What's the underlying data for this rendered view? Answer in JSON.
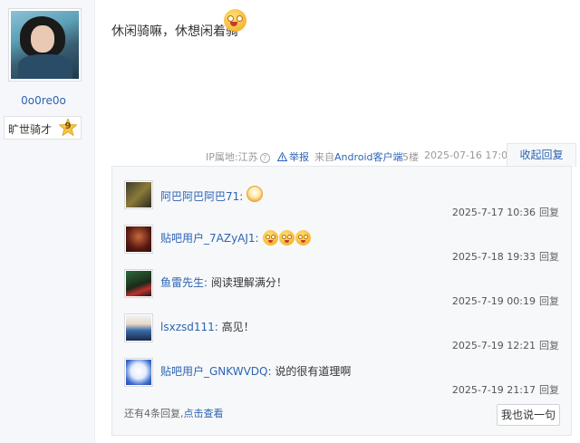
{
  "author": {
    "username": "0o0re0o",
    "level_name": "旷世骑才",
    "level_number": "9"
  },
  "post": {
    "text": "休闲骑嘛，休想闲着骑"
  },
  "meta": {
    "ip_location": "IP属地:江苏",
    "report_label": "举报",
    "source_prefix": "来自",
    "source_link": "Android客户端",
    "floor": "5楼",
    "datetime": "2025-07-16 17:01",
    "collapse_label": "收起回复"
  },
  "replies": [
    {
      "user": "阿巴阿巴阿巴71:",
      "text": "",
      "time": "2025-7-17 10:36",
      "reply_label": "回复"
    },
    {
      "user": "贴吧用户_7AZyAJ1:",
      "text": "",
      "time": "2025-7-18 19:33",
      "reply_label": "回复"
    },
    {
      "user": "鱼雷先生:",
      "text": "阅读理解满分！",
      "time": "2025-7-19 00:19",
      "reply_label": "回复"
    },
    {
      "user": "lsxzsd111:",
      "text": "高见！",
      "time": "2025-7-19 12:21",
      "reply_label": "回复"
    },
    {
      "user": "贴吧用户_GNKWVDQ:",
      "text": "说的很有道理啊",
      "time": "2025-7-19 21:17",
      "reply_label": "回复"
    }
  ],
  "more": {
    "text": "还有4条回复,",
    "link": "点击查看",
    "button": "我也说一句"
  },
  "colors": {
    "link": "#2d64b3",
    "panel_bg": "#f7f8fa"
  }
}
